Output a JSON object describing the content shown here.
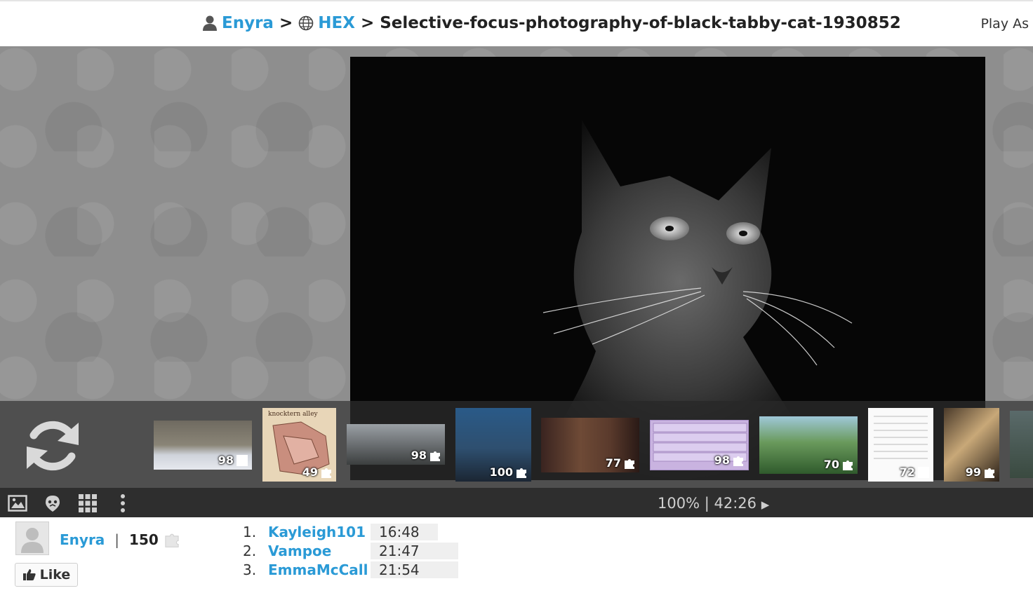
{
  "header": {
    "user": "Enyra",
    "sep1": ">",
    "group": "HEX",
    "sep2": ">",
    "puzzle_title": "Selective-focus-photography-of-black-tabby-cat-1930852",
    "play_as": "Play As"
  },
  "thumbnails": [
    {
      "count": "98",
      "badge": "square"
    },
    {
      "count": "49",
      "badge": "puzzle",
      "caption": "knocktern alley"
    },
    {
      "count": "98",
      "badge": "puzzle"
    },
    {
      "count": "100",
      "badge": "puzzle"
    },
    {
      "count": "77",
      "badge": "puzzle"
    },
    {
      "count": "98",
      "badge": "puzzle"
    },
    {
      "count": "70",
      "badge": "puzzle"
    },
    {
      "count": "72",
      "badge": "square"
    },
    {
      "count": "99",
      "badge": "puzzle"
    }
  ],
  "toolbar": {
    "zoom": "100%",
    "divider": "|",
    "timer": "42:26",
    "play_icon": "▶"
  },
  "profile": {
    "username": "Enyra",
    "divider": "|",
    "score": "150",
    "like_label": "Like"
  },
  "leaderboard": [
    {
      "rank": "1.",
      "name": "Kayleigh101",
      "time": "16:48"
    },
    {
      "rank": "2.",
      "name": "Vampoe",
      "time": "21:47"
    },
    {
      "rank": "3.",
      "name": "EmmaMcCall",
      "time": "21:54"
    }
  ],
  "colors": {
    "accent": "#2a9ad6",
    "toolbar": "#2e2e2e",
    "stage": "#8e8e8e"
  }
}
